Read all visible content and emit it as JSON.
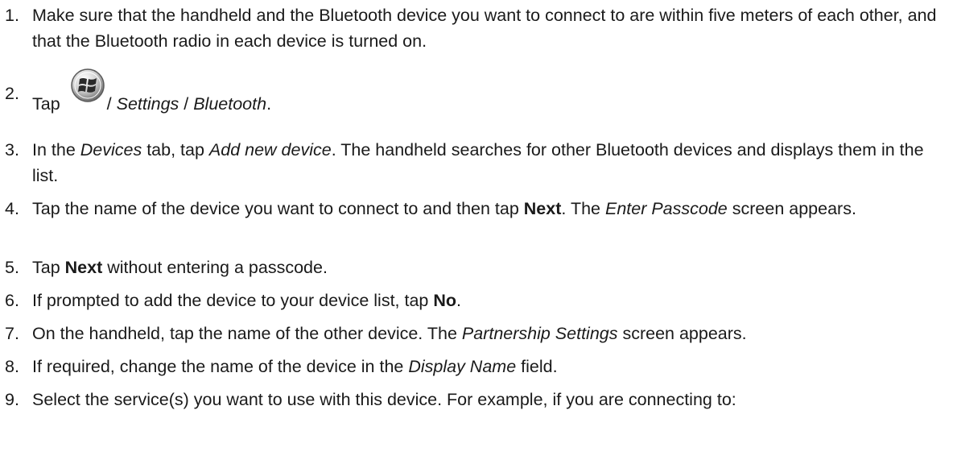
{
  "steps": [
    {
      "num": "1.",
      "text": "Make sure that the handheld and the Bluetooth device you want to connect to are within five meters of each other, and that the Bluetooth radio in each device is turned on."
    },
    {
      "num": "2.",
      "tap": "Tap",
      "path": [
        "/ ",
        "Settings",
        " / ",
        "Bluetooth",
        "."
      ],
      "icon": "windows-start-icon"
    },
    {
      "num": "3.",
      "parts": [
        "In the ",
        "Devices",
        " tab, tap ",
        "Add new device",
        ". The handheld searches for other Bluetooth devices and displays them in the list."
      ]
    },
    {
      "num": "4.",
      "parts": [
        "Tap the name of the device you want to connect to and then tap ",
        "Next",
        ". The ",
        "Enter Passcode",
        " screen appears."
      ]
    },
    {
      "num": "5.",
      "parts": [
        "Tap ",
        "Next",
        " without entering a passcode."
      ]
    },
    {
      "num": "6.",
      "parts": [
        "If prompted to add the device to your device list, tap ",
        "No",
        "."
      ]
    },
    {
      "num": "7.",
      "parts": [
        "On the handheld, tap the name of the other device. The ",
        "Partnership Settings",
        " screen appears."
      ]
    },
    {
      "num": "8.",
      "parts": [
        "If required, change the name of the device in the ",
        "Display Name",
        " field."
      ]
    },
    {
      "num": "9.",
      "text": "Select the service(s) you want to use with this device. For example, if you are connecting to:"
    }
  ]
}
